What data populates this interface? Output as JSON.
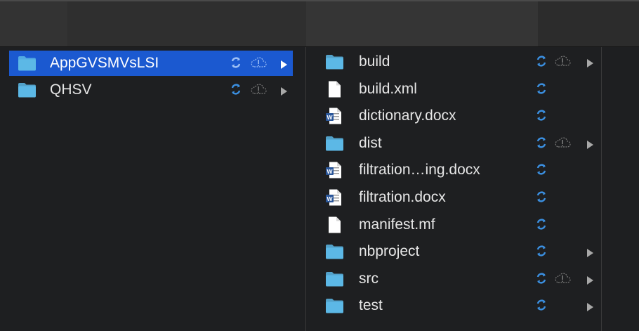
{
  "columns": {
    "left": {
      "items": [
        {
          "name": "AppGVSMVsLSI",
          "type": "folder-icon",
          "selected": true,
          "sync": true,
          "cloud": true,
          "chevron": true
        },
        {
          "name": "QHSV",
          "type": "folder-icon",
          "selected": false,
          "sync": true,
          "cloud": true,
          "chevron": true
        }
      ]
    },
    "right": {
      "items": [
        {
          "name": "build",
          "type": "folder-icon",
          "sync": true,
          "cloud": true,
          "chevron": true
        },
        {
          "name": "build.xml",
          "type": "file-icon",
          "sync": true,
          "cloud": false,
          "chevron": false
        },
        {
          "name": "dictionary.docx",
          "type": "word-doc-icon",
          "sync": true,
          "cloud": false,
          "chevron": false
        },
        {
          "name": "dist",
          "type": "folder-icon",
          "sync": true,
          "cloud": true,
          "chevron": true
        },
        {
          "name": "filtration…ing.docx",
          "type": "word-doc-icon",
          "sync": true,
          "cloud": false,
          "chevron": false
        },
        {
          "name": "filtration.docx",
          "type": "word-doc-icon",
          "sync": true,
          "cloud": false,
          "chevron": false
        },
        {
          "name": "manifest.mf",
          "type": "file-icon",
          "sync": true,
          "cloud": false,
          "chevron": false
        },
        {
          "name": "nbproject",
          "type": "folder-icon",
          "sync": true,
          "cloud": false,
          "chevron": true
        },
        {
          "name": "src",
          "type": "folder-icon",
          "sync": true,
          "cloud": true,
          "chevron": true
        },
        {
          "name": "test",
          "type": "folder-icon",
          "sync": true,
          "cloud": false,
          "chevron": true
        }
      ]
    }
  },
  "colors": {
    "selection": "#1b59d0",
    "folder": "#5cb8e6",
    "sync": "#3b8fe0",
    "background": "#1e1f21"
  }
}
